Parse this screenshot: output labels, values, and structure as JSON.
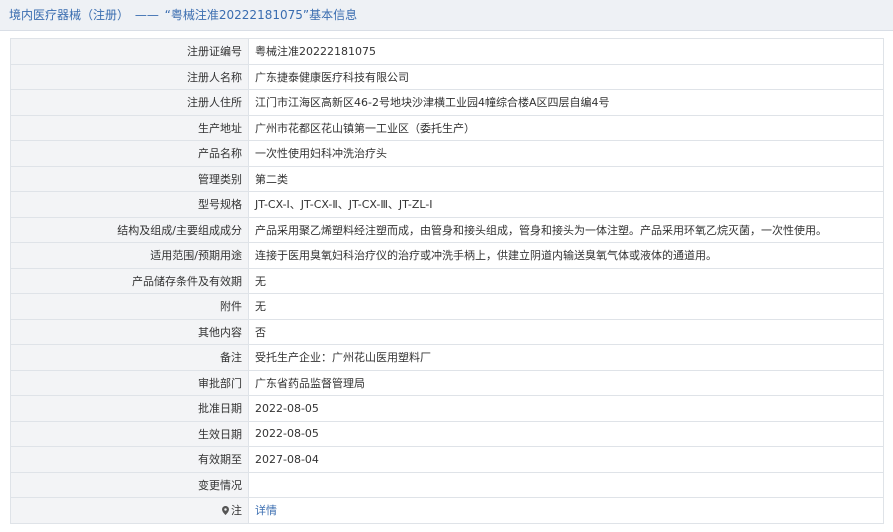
{
  "header": {
    "category": "境内医疗器械（注册）",
    "separator": "——",
    "record_title": "“粤械注准20222181075”基本信息"
  },
  "rows": [
    {
      "label": "注册证编号",
      "value": "粤械注准20222181075"
    },
    {
      "label": "注册人名称",
      "value": "广东捷泰健康医疗科技有限公司"
    },
    {
      "label": "注册人住所",
      "value": "江门市江海区高新区46-2号地块沙津横工业园4幢综合楼A区四层自编4号"
    },
    {
      "label": "生产地址",
      "value": "广州市花都区花山镇第一工业区（委托生产）"
    },
    {
      "label": "产品名称",
      "value": "一次性使用妇科冲洗治疗头"
    },
    {
      "label": "管理类别",
      "value": "第二类"
    },
    {
      "label": "型号规格",
      "value": "JT-CX-Ⅰ、JT-CX-Ⅱ、JT-CX-Ⅲ、JT-ZL-Ⅰ"
    },
    {
      "label": "结构及组成/主要组成成分",
      "value": "产品采用聚乙烯塑料经注塑而成，由管身和接头组成，管身和接头为一体注塑。产品采用环氧乙烷灭菌，一次性使用。"
    },
    {
      "label": "适用范围/预期用途",
      "value": "连接于医用臭氧妇科治疗仪的治疗或冲洗手柄上，供建立阴道内输送臭氧气体或液体的通道用。"
    },
    {
      "label": "产品储存条件及有效期",
      "value": "无"
    },
    {
      "label": "附件",
      "value": "无"
    },
    {
      "label": "其他内容",
      "value": "否"
    },
    {
      "label": "备注",
      "value": "受托生产企业：广州花山医用塑料厂"
    },
    {
      "label": "审批部门",
      "value": "广东省药品监督管理局"
    },
    {
      "label": "批准日期",
      "value": "2022-08-05"
    },
    {
      "label": "生效日期",
      "value": "2022-08-05"
    },
    {
      "label": "有效期至",
      "value": "2027-08-04"
    },
    {
      "label": "变更情况",
      "value": ""
    }
  ],
  "note_row": {
    "icon": "location-pin-icon",
    "label": "注",
    "link_text": "详情"
  },
  "colors": {
    "accent": "#3a6db0",
    "label_bg": "#f3f4f6",
    "border": "#dfe3e8"
  }
}
